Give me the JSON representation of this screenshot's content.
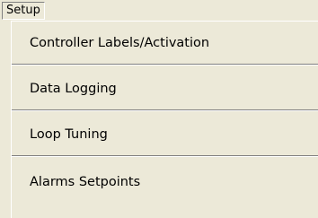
{
  "menubar": {
    "title": "Setup"
  },
  "menu": {
    "items": [
      {
        "label": "Controller Labels/Activation"
      },
      {
        "label": "Data Logging"
      },
      {
        "label": "Loop Tuning"
      },
      {
        "label": "Alarms Setpoints"
      }
    ]
  },
  "colors": {
    "background": "#ece9d8",
    "border_dark": "#808080",
    "border_light": "#ffffff",
    "text": "#000000"
  }
}
